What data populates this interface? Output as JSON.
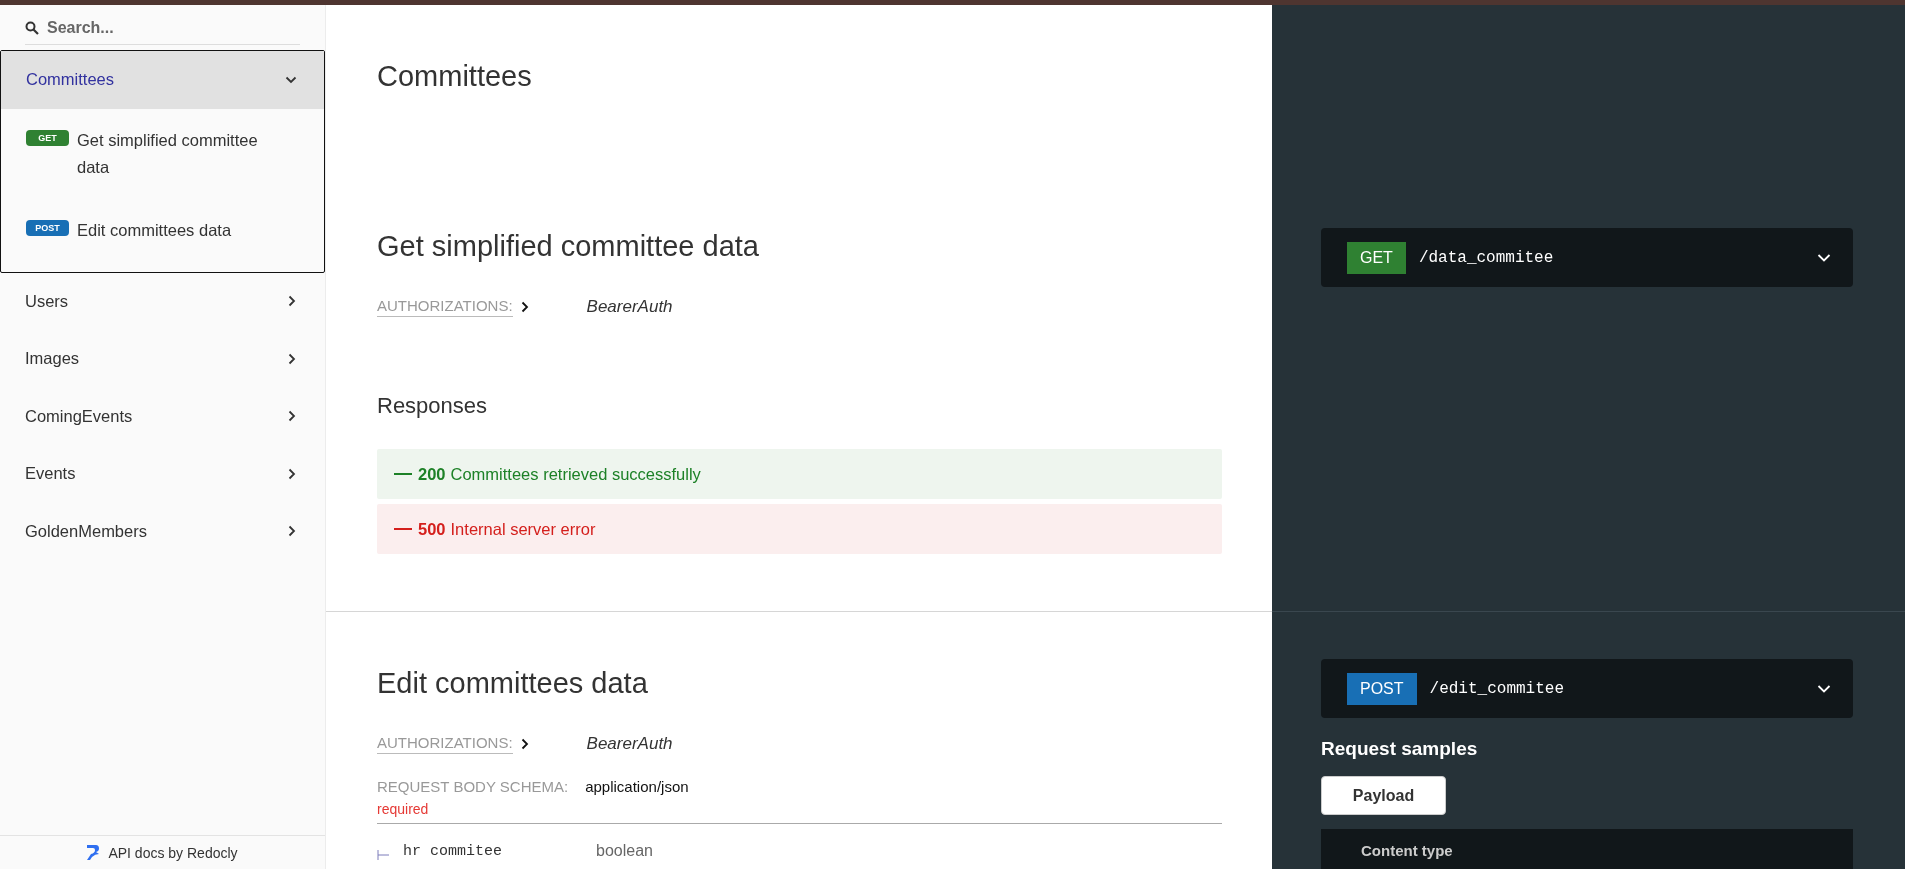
{
  "sidebar": {
    "search": {
      "placeholder": "Search..."
    },
    "groups": [
      {
        "label": "Committees",
        "expanded": true,
        "selected": true,
        "operations": [
          {
            "method": "GET",
            "color": "#2f8132",
            "label": "Get simplified committee data"
          },
          {
            "method": "POST",
            "color": "#186fb5",
            "label": "Edit committees data"
          }
        ]
      },
      {
        "label": "Users",
        "expanded": false,
        "selected": false
      },
      {
        "label": "Images",
        "expanded": false,
        "selected": false
      },
      {
        "label": "ComingEvents",
        "expanded": false,
        "selected": false
      },
      {
        "label": "Events",
        "expanded": false,
        "selected": false
      },
      {
        "label": "GoldenMembers",
        "expanded": false,
        "selected": false
      }
    ],
    "footer": "API docs by Redocly"
  },
  "main": {
    "title": "Committees",
    "operations": [
      {
        "title": "Get simplified committee data",
        "authorizations": {
          "label": "AUTHORIZATIONS:",
          "scheme": "BearerAuth"
        },
        "responses": {
          "title": "Responses",
          "items": [
            {
              "kind": "success",
              "code": "200",
              "text": "Committees retrieved successfully"
            },
            {
              "kind": "error",
              "code": "500",
              "text": "Internal server error"
            }
          ]
        },
        "endpoint": {
          "method": "GET",
          "color": "#2f8132",
          "path": "/data_commitee",
          "expanded": false
        }
      },
      {
        "title": "Edit committees data",
        "authorizations": {
          "label": "AUTHORIZATIONS:",
          "scheme": "BearerAuth"
        },
        "request_body": {
          "label": "REQUEST BODY SCHEMA:",
          "content_type": "application/json",
          "required": "required",
          "fields": [
            {
              "name": "hr commitee",
              "type": "boolean"
            }
          ]
        },
        "endpoint": {
          "method": "POST",
          "color": "#186fb5",
          "path": "/edit_commitee",
          "expanded": false
        },
        "request_samples": {
          "title": "Request samples",
          "tabs": [
            {
              "label": "Payload",
              "selected": true
            }
          ],
          "content_type_label": "Content type"
        }
      }
    ]
  }
}
